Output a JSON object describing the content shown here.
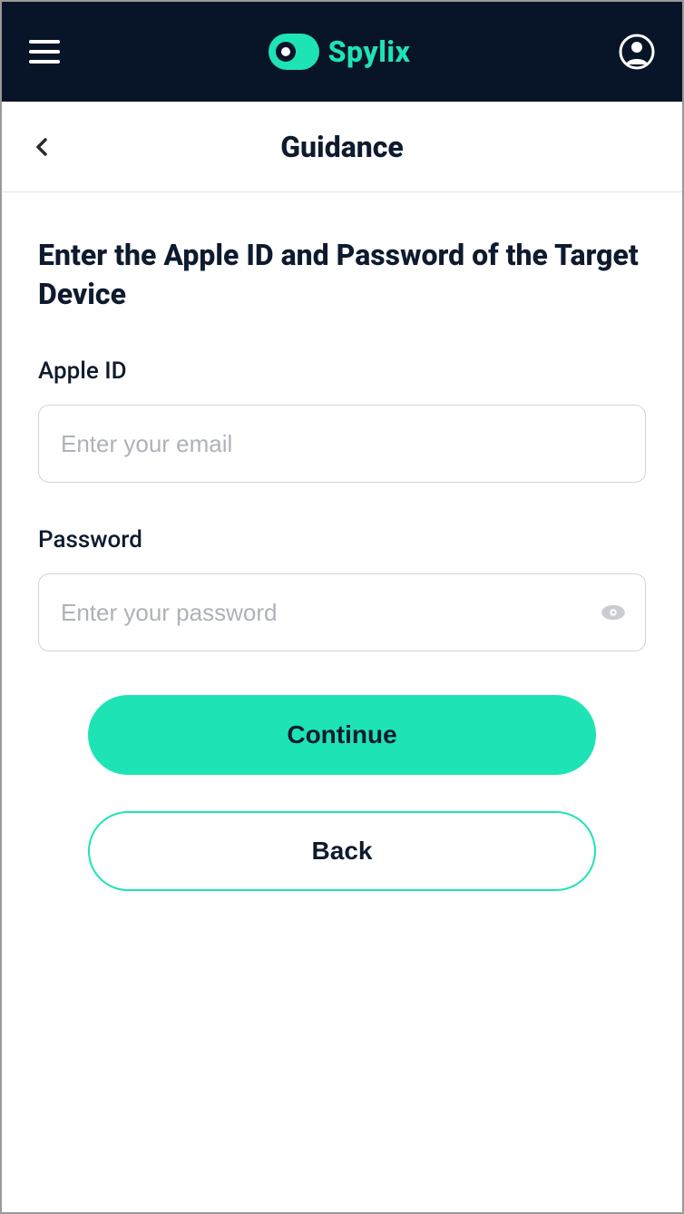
{
  "header": {
    "brand_text": "Spylix"
  },
  "subheader": {
    "title": "Guidance"
  },
  "page": {
    "title": "Enter the Apple ID and Password of the Target Device"
  },
  "fields": {
    "apple_id": {
      "label": "Apple ID",
      "placeholder": "Enter your email",
      "value": ""
    },
    "password": {
      "label": "Password",
      "placeholder": "Enter your password",
      "value": ""
    }
  },
  "buttons": {
    "continue": "Continue",
    "back": "Back"
  },
  "colors": {
    "accent": "#1ee3b5",
    "header_bg": "#081428",
    "text": "#0e1b2e"
  }
}
